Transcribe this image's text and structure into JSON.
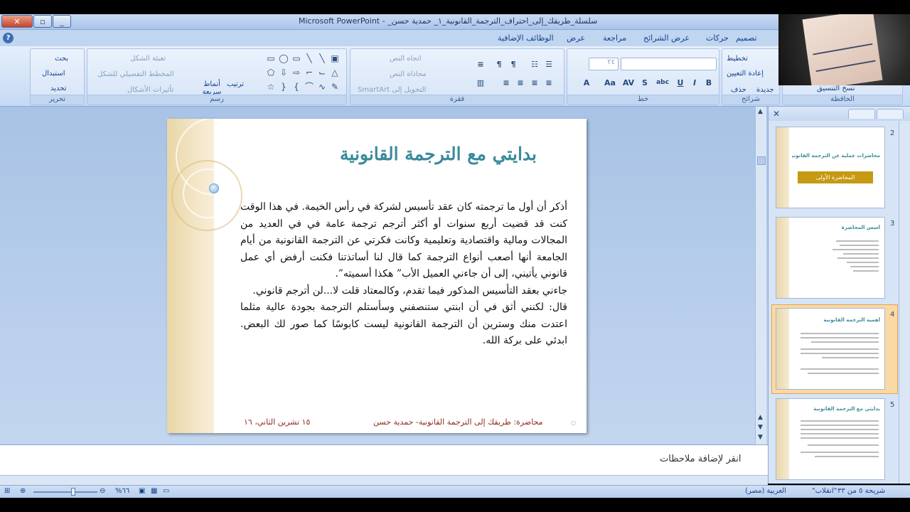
{
  "window": {
    "title": "سلسلة_طريقك_إلى_احتراف_الترجمة_القانونية_١_ حمدية حسن_ - Microsoft PowerPoint",
    "close_glyph": "✕",
    "maximize_glyph": "▫",
    "minimize_glyph": "_"
  },
  "ribbon_tabs": [
    "تصميم",
    "حركات",
    "عرض الشرائح",
    "مراجعة",
    "عرض",
    "الوظائف الإضافية"
  ],
  "ribbon": {
    "clipboard": {
      "label": "الحافظة",
      "copy_format": "نسخ التنسيق"
    },
    "slides": {
      "label": "شرائح",
      "layout": "تخطيط",
      "reset": "إعادة التعيين",
      "new": "جديدة",
      "delete": "حذف"
    },
    "font": {
      "label": "خط",
      "size": "٢٤"
    },
    "paragraph": {
      "label": "فقرة",
      "text_direction": "اتجاه النص",
      "align_text": "محاذاة النص",
      "convert_smartart": "التحويل إلى SmartArt"
    },
    "drawing": {
      "label": "رسم",
      "arrange": "ترتيب",
      "quick_styles": "أنماط سريعة",
      "shape_fill": "تعبئة الشكل",
      "shape_outline": "المخطط التفصيلي للشكل",
      "shape_effects": "تأثيرات الأشكال"
    },
    "editing": {
      "label": "تحرير",
      "find": "بحث",
      "replace": "استبدال",
      "select": "تحديد"
    }
  },
  "slide": {
    "title": "بدايتي مع الترجمة القانونية",
    "paragraphs": [
      "أذكر أن أول ما ترجمته كان عقد تأسيس لشركة في رأس الخيمة. في هذا الوقت كنت قد قضيت أربع سنوات أو أكثر أترجم ترجمة عامة في في العديد من المجالات ومالية واقتصادية وتعليمية وكانت فكرتي عن الترجمة القانونية من أيام الجامعة أنها أصعب أنواع الترجمة كما قال لنا أساتذتنا فكنت أرفض أي عمل قانوني يأتيني، إلى أن جاءني العميل الأب” هكذا أسميته”.",
      "جاءني بعقد التأسيس المذكور فيما تقدم، وكالمعتاد قلت لا...لن أترجم قانوني.",
      "قال: لكنني أثق في أن ابنتي ستنصفني وسأستلم الترجمة بجودة عالية مثلما اعتدت منك وسترين أن الترجمة القانونية ليست كابوسًا كما صور لك البعض. ابدئي على بركة الله."
    ],
    "footer_lecture": "محاضرة: طريقك إلى الترجمة القانونية- حمدية حسن",
    "footer_date": "١٥ تشرين الثاني، ١٦"
  },
  "thumbnails": [
    {
      "num": "2",
      "title": "محاضرات عملية عن الترجمة القانونية",
      "button": "المحاضرة الأولى"
    },
    {
      "num": "3",
      "title": "أسس المحاضرة"
    },
    {
      "num": "4",
      "title": "أهمية الترجمة القانونية"
    },
    {
      "num": "5",
      "title": "بدايتي مع الترجمة القانونية"
    }
  ],
  "notes_placeholder": "انقر لإضافة ملاحظات",
  "status": {
    "slide_info": "شريحة ٥ من ٣٣",
    "theme": "\"انقلاب\"",
    "language": "العربية (مصر)",
    "zoom": "٦٦%"
  },
  "icons": [
    "help-icon",
    "close-icon",
    "maximize-icon",
    "minimize-icon"
  ],
  "colors": {
    "title": "#3a8a9c",
    "footer": "#8e2a1a",
    "selection": "#f0a239"
  }
}
